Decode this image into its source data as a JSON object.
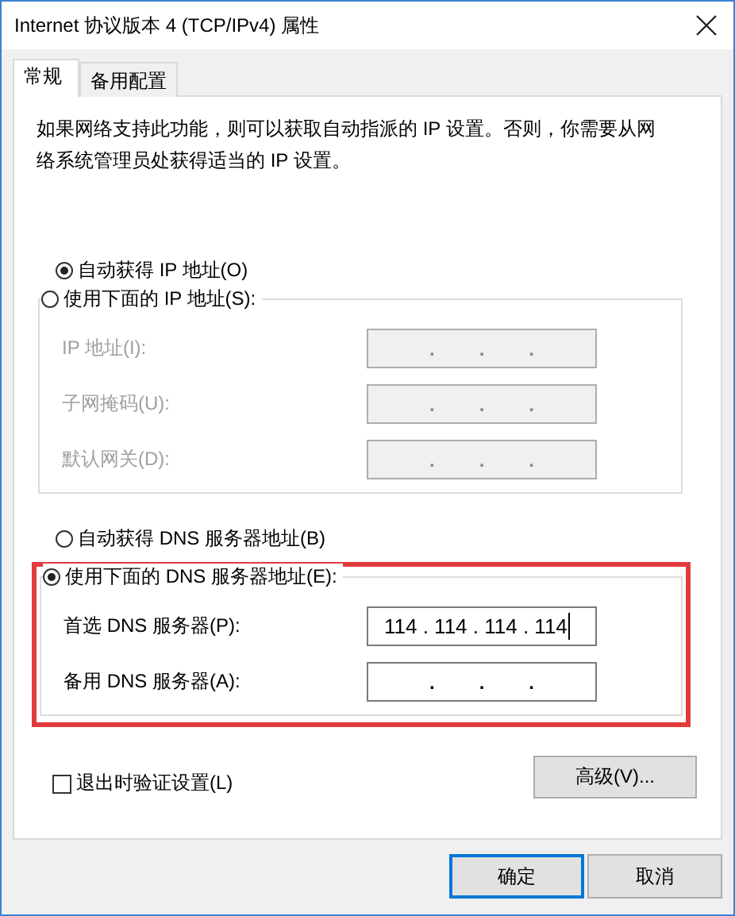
{
  "window": {
    "title": "Internet 协议版本 4 (TCP/IPv4) 属性"
  },
  "tabs": [
    {
      "label": "常规",
      "selected": true
    },
    {
      "label": "备用配置",
      "selected": false
    }
  ],
  "description": "如果网络支持此功能，则可以获取自动指派的 IP 设置。否则，你需要从网络系统管理员处获得适当的 IP 设置。",
  "ip_mode": [
    {
      "label": "自动获得 IP 地址(O)",
      "selected": true
    },
    {
      "label": "使用下面的 IP 地址(S):",
      "selected": false
    }
  ],
  "ip_fields": {
    "disabled": true,
    "items": [
      {
        "label": "IP 地址(I):",
        "dots": [
          ".",
          ".",
          "."
        ]
      },
      {
        "label": "子网掩码(U):",
        "dots": [
          ".",
          ".",
          "."
        ]
      },
      {
        "label": "默认网关(D):",
        "dots": [
          ".",
          ".",
          "."
        ]
      }
    ]
  },
  "dns_mode": [
    {
      "label": "自动获得 DNS 服务器地址(B)",
      "selected": false
    },
    {
      "label": "使用下面的 DNS 服务器地址(E):",
      "selected": true
    }
  ],
  "dns_fields": {
    "disabled": false,
    "highlighted": true,
    "items": [
      {
        "label": "首选 DNS 服务器(P):",
        "value": "114 . 114 . 114 . 114",
        "focused": true
      },
      {
        "label": "备用 DNS 服务器(A):",
        "dots": [
          ".",
          ".",
          "."
        ],
        "focused": false
      }
    ]
  },
  "validate_on_exit": {
    "label": "退出时验证设置(L)",
    "checked": false
  },
  "advanced_button": "高级(V)...",
  "buttons": [
    {
      "label": "确定",
      "default": true
    },
    {
      "label": "取消",
      "default": false
    }
  ]
}
